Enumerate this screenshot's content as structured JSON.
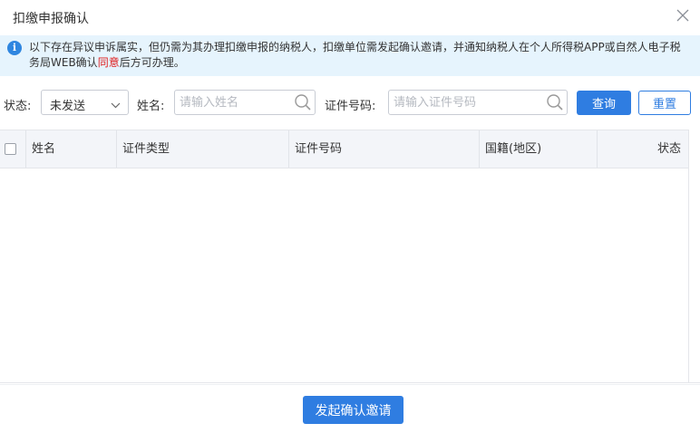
{
  "dialog": {
    "title": "扣缴申报确认",
    "close_icon": "close-icon"
  },
  "notice": {
    "icon": "info-icon",
    "icon_glyph": "i",
    "text_before": "以下存在异议申诉属实，但仍需为其办理扣缴申报的纳税人，扣缴单位需发起确认邀请，并通知纳税人在个人所得税APP或自然人电子税务局WEB确认",
    "text_highlight": "同意",
    "text_after": "后方可办理。",
    "highlight_color": "#e02020"
  },
  "filters": {
    "status_label": "状态:",
    "status_value": "未发送",
    "name_label": "姓名:",
    "name_placeholder": "请输入姓名",
    "name_value": "",
    "id_label": "证件号码:",
    "id_placeholder": "请输入证件号码",
    "id_value": "",
    "query_button": "查询",
    "reset_button": "重置"
  },
  "table": {
    "columns": [
      "姓名",
      "证件类型",
      "证件号码",
      "国籍(地区)",
      "状态"
    ],
    "rows": []
  },
  "footer": {
    "invite_button": "发起确认邀请"
  },
  "colors": {
    "primary": "#2f7de1",
    "notice_bg": "#e6f4fd",
    "header_bg": "#f3f5f9"
  }
}
